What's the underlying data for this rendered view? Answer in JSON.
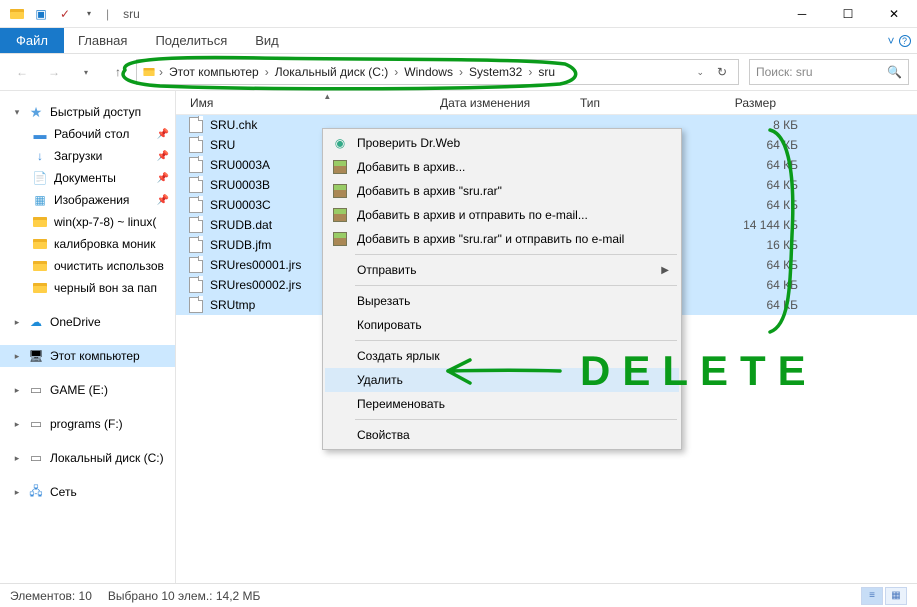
{
  "title": {
    "ql_sep": "|",
    "folder": "sru"
  },
  "ribbon": {
    "file": "Файл",
    "tabs": [
      "Главная",
      "Поделиться",
      "Вид"
    ]
  },
  "breadcrumbs": [
    "Этот компьютер",
    "Локальный диск (C:)",
    "Windows",
    "System32",
    "sru"
  ],
  "search": {
    "placeholder": "Поиск: sru"
  },
  "columns": {
    "name": "Имя",
    "date": "Дата изменения",
    "type": "Тип",
    "size": "Размер"
  },
  "nav": {
    "quick": "Быстрый доступ",
    "quick_items": [
      "Рабочий стол",
      "Загрузки",
      "Документы",
      "Изображения",
      "win(xp-7-8) ~ linux(",
      "калибровка моник",
      "очистить использов",
      "черный вон за пап"
    ],
    "onedrive": "OneDrive",
    "thispc": "Этот компьютер",
    "drives": [
      "GAME (E:)",
      "programs (F:)",
      "Локальный диск (C:)"
    ],
    "network": "Сеть"
  },
  "files": [
    {
      "name": "SRU.chk",
      "size": "8 КБ"
    },
    {
      "name": "SRU",
      "size": "64 КБ"
    },
    {
      "name": "SRU0003A",
      "size": "64 КБ"
    },
    {
      "name": "SRU0003B",
      "size": "64 КБ"
    },
    {
      "name": "SRU0003C",
      "size": "64 КБ"
    },
    {
      "name": "SRUDB.dat",
      "size": "14 144 КБ"
    },
    {
      "name": "SRUDB.jfm",
      "size": "16 КБ"
    },
    {
      "name": "SRUres00001.jrs",
      "size": "64 КБ"
    },
    {
      "name": "SRUres00002.jrs",
      "size": "64 КБ"
    },
    {
      "name": "SRUtmp",
      "size": "64 КБ"
    }
  ],
  "ctx": {
    "drweb": "Проверить Dr.Web",
    "rar_add": "Добавить в архив...",
    "rar_add_sru": "Добавить в архив \"sru.rar\"",
    "rar_email": "Добавить в архив и отправить по e-mail...",
    "rar_email_sru": "Добавить в архив \"sru.rar\" и отправить по e-mail",
    "send": "Отправить",
    "cut": "Вырезать",
    "copy": "Копировать",
    "shortcut": "Создать ярлык",
    "delete": "Удалить",
    "rename": "Переименовать",
    "props": "Свойства"
  },
  "status": {
    "count": "Элементов: 10",
    "selected": "Выбрано 10 элем.: 14,2 МБ"
  },
  "annot_text": "DELETE"
}
